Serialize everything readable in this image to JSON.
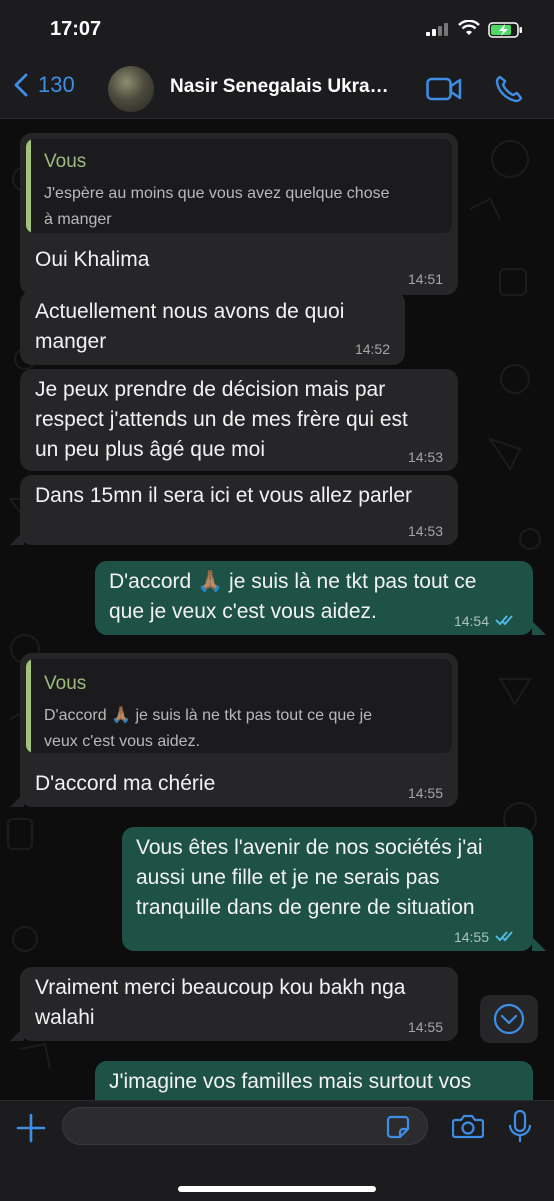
{
  "status": {
    "time": "17:07"
  },
  "header": {
    "back_count": "130",
    "contact_name": "Nasir Senegalais Ukra…"
  },
  "messages": [
    {
      "dir": "in",
      "quote_author": "Vous",
      "quote_text": "J'espère au moins que vous avez quelque chose\nà manger",
      "text": "Oui Khalima",
      "time": "14:51"
    },
    {
      "dir": "in",
      "text": "Actuellement nous avons de quoi\nmanger",
      "time": "14:52"
    },
    {
      "dir": "in",
      "text": "Je peux prendre de décision mais par\nrespect j'attends un de mes frère qui est\nun peu plus âgé que moi",
      "time": "14:53"
    },
    {
      "dir": "in",
      "text": "Dans 15mn il sera ici et vous allez parler",
      "time": "14:53"
    },
    {
      "dir": "out",
      "text": "D'accord 🙏🏽 je suis là ne tkt pas tout ce\nque je veux c'est vous aidez.",
      "time": "14:54"
    },
    {
      "dir": "in",
      "quote_author": "Vous",
      "quote_text": "D'accord 🙏🏽 je suis là ne tkt pas tout ce que je\nveux c'est vous aidez.",
      "text": "D'accord ma chérie",
      "time": "14:55"
    },
    {
      "dir": "out",
      "text": "Vous êtes l'avenir de nos sociétés j'ai\naussi une fille et je ne serais pas\ntranquille dans de genre de situation",
      "time": "14:55"
    },
    {
      "dir": "in",
      "text": "Vraiment merci beaucoup kou bakh nga\nwalahi",
      "time": "14:55"
    },
    {
      "dir": "out",
      "text": "J'imagine vos familles mais surtout vos"
    }
  ],
  "icons": {
    "back": "chevron-left-icon",
    "video": "video-call-icon",
    "call": "phone-icon",
    "plus": "plus-icon",
    "sticker": "sticker-icon",
    "camera": "camera-icon",
    "mic": "microphone-icon",
    "scroll": "chevron-down-circle-icon"
  },
  "colors": {
    "accent": "#3e8ee6",
    "incoming": "#262628",
    "outgoing": "#1f5247",
    "quote_author": "#9ebb82"
  }
}
